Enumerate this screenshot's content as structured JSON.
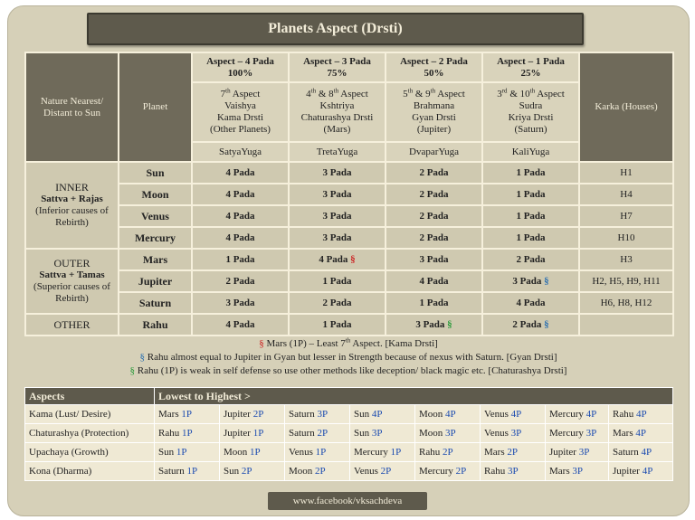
{
  "title": "Planets Aspect (Drsti)",
  "header": {
    "nature": "Nature Nearest/ Distant to Sun",
    "planet": "Planet",
    "karka": "Karka (Houses)",
    "cols": [
      {
        "aspect": "Aspect – 4 Pada",
        "pct": "100%",
        "line1": "7th Aspect",
        "line2": "Vaishya",
        "line3": "Kama Drsti",
        "line4": "(Other Planets)",
        "yuga": "SatyaYuga"
      },
      {
        "aspect": "Aspect – 3 Pada",
        "pct": "75%",
        "line1": "4th & 8th Aspect",
        "line2": "Kshtriya",
        "line3": "Chaturashya Drsti",
        "line4": "(Mars)",
        "yuga": "TretaYuga"
      },
      {
        "aspect": "Aspect – 2 Pada",
        "pct": "50%",
        "line1": "5th & 9th Aspect",
        "line2": "Brahmana",
        "line3": "Gyan Drsti",
        "line4": "(Jupiter)",
        "yuga": "DvaparYuga"
      },
      {
        "aspect": "Aspect – 1 Pada",
        "pct": "25%",
        "line1": "3rd & 10th Aspect",
        "line2": "Sudra",
        "line3": "Kriya Drsti",
        "line4": "(Saturn)",
        "yuga": "KaliYuga"
      }
    ]
  },
  "groups": {
    "inner": {
      "label": "INNER",
      "bold": "Sattva + Rajas",
      "sub": "(Inferior causes of Rebirth)"
    },
    "outer": {
      "label": "OUTER",
      "bold": "Sattva + Tamas",
      "sub": "(Superior causes of Rebirth)"
    },
    "other": {
      "label": "OTHER"
    }
  },
  "rows": [
    {
      "planet": "Sun",
      "c1": "4 Pada",
      "c2": "3 Pada",
      "c3": "2 Pada",
      "c4": "1 Pada",
      "karka": "H1"
    },
    {
      "planet": "Moon",
      "c1": "4 Pada",
      "c2": "3 Pada",
      "c3": "2 Pada",
      "c4": "1 Pada",
      "karka": "H4"
    },
    {
      "planet": "Venus",
      "c1": "4 Pada",
      "c2": "3 Pada",
      "c3": "2 Pada",
      "c4": "1 Pada",
      "karka": "H7"
    },
    {
      "planet": "Mercury",
      "c1": "4 Pada",
      "c2": "3 Pada",
      "c3": "2 Pada",
      "c4": "1 Pada",
      "karka": "H10"
    },
    {
      "planet": "Mars",
      "c1": "1 Pada",
      "c2": "4 Pada",
      "c3": "3 Pada",
      "c4": "2 Pada",
      "karka": "H3"
    },
    {
      "planet": "Jupiter",
      "c1": "2 Pada",
      "c2": "1 Pada",
      "c3": "4 Pada",
      "c4": "3 Pada",
      "karka": "H2, H5, H9, H11"
    },
    {
      "planet": "Saturn",
      "c1": "3 Pada",
      "c2": "2 Pada",
      "c3": "1 Pada",
      "c4": "4 Pada",
      "karka": "H6, H8, H12"
    },
    {
      "planet": "Rahu",
      "c1": "4 Pada",
      "c2": "1 Pada",
      "c3": "3 Pada",
      "c4": "2 Pada",
      "karka": ""
    }
  ],
  "marker": "§",
  "notes": {
    "n1a": "Mars (1P) – Least 7",
    "n1b": "th",
    "n1c": " Aspect. [Kama Drsti]",
    "n2": "Rahu almost equal to Jupiter in Gyan but lesser in Strength because of nexus with Saturn. [Gyan Drsti]",
    "n3": "Rahu (1P) is weak in self defense so use other methods like deception/ black magic etc. [Chaturashya Drsti]"
  },
  "aspects": {
    "h1": "Aspects",
    "h2": "Lowest to Highest >",
    "rows": [
      {
        "label": "Kama (Lust/ Desire)",
        "cells": [
          [
            "Mars",
            "1P"
          ],
          [
            "Jupiter",
            "2P"
          ],
          [
            "Saturn",
            "3P"
          ],
          [
            "Sun",
            "4P"
          ],
          [
            "Moon",
            "4P"
          ],
          [
            "Venus",
            "4P"
          ],
          [
            "Mercury",
            "4P"
          ],
          [
            "Rahu",
            "4P"
          ]
        ]
      },
      {
        "label": "Chaturashya (Protection)",
        "cells": [
          [
            "Rahu",
            "1P"
          ],
          [
            "Jupiter",
            "1P"
          ],
          [
            "Saturn",
            "2P"
          ],
          [
            "Sun",
            "3P"
          ],
          [
            "Moon",
            "3P"
          ],
          [
            "Venus",
            "3P"
          ],
          [
            "Mercury",
            "3P"
          ],
          [
            "Mars",
            "4P"
          ]
        ]
      },
      {
        "label": "Upachaya (Growth)",
        "cells": [
          [
            "Sun",
            "1P"
          ],
          [
            "Moon",
            "1P"
          ],
          [
            "Venus",
            "1P"
          ],
          [
            "Mercury",
            "1P"
          ],
          [
            "Rahu",
            "2P"
          ],
          [
            "Mars",
            "2P"
          ],
          [
            "Jupiter",
            "3P"
          ],
          [
            "Saturn",
            "4P"
          ]
        ]
      },
      {
        "label": "Kona (Dharma)",
        "cells": [
          [
            "Saturn",
            "1P"
          ],
          [
            "Sun",
            "2P"
          ],
          [
            "Moon",
            "2P"
          ],
          [
            "Venus",
            "2P"
          ],
          [
            "Mercury",
            "2P"
          ],
          [
            "Rahu",
            "3P"
          ],
          [
            "Mars",
            "3P"
          ],
          [
            "Jupiter",
            "4P"
          ]
        ]
      }
    ]
  },
  "footer": "www.facebook/vksachdeva",
  "colors": {
    "red": "#cc2222",
    "blue": "#2a6fb0",
    "green": "#2a9a3a"
  }
}
